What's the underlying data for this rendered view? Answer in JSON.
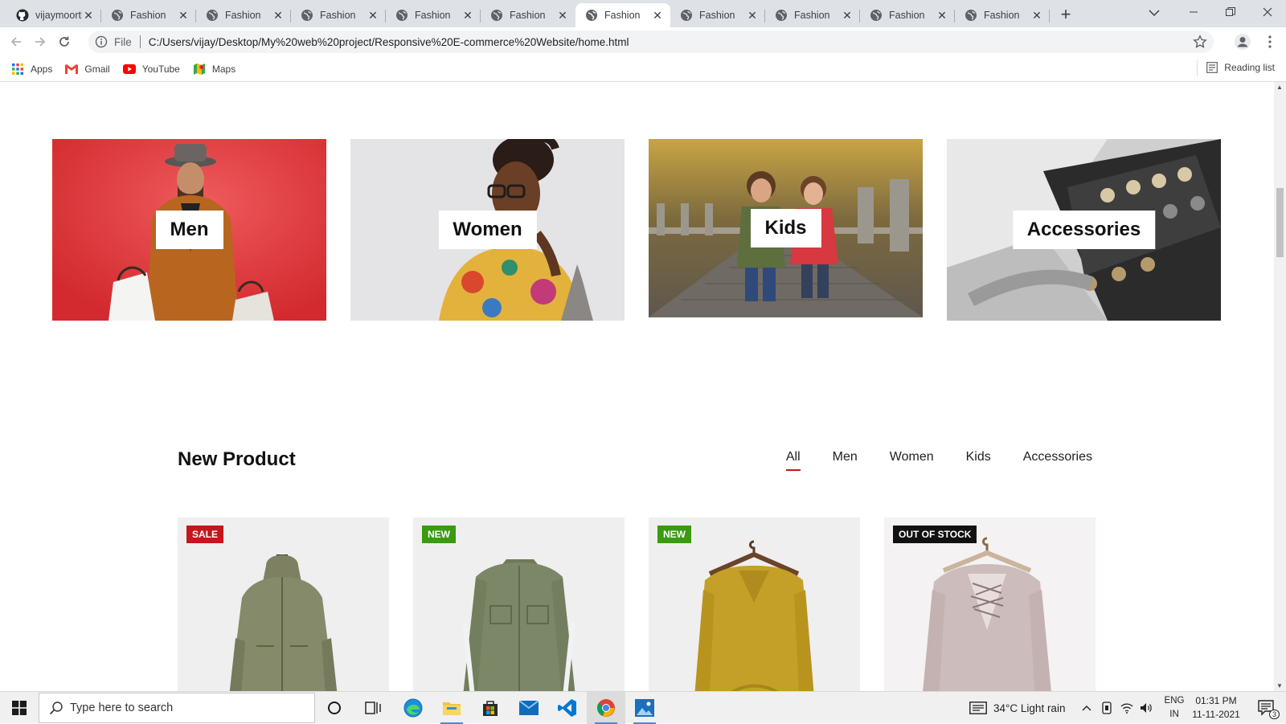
{
  "browser": {
    "tabs": [
      {
        "title": "vijaymoorthy",
        "favicon": "github-icon",
        "active": false
      },
      {
        "title": "Fashion",
        "favicon": "globe-icon",
        "active": false
      },
      {
        "title": "Fashion",
        "favicon": "globe-icon",
        "active": false
      },
      {
        "title": "Fashion",
        "favicon": "globe-icon",
        "active": false
      },
      {
        "title": "Fashion",
        "favicon": "globe-icon",
        "active": false
      },
      {
        "title": "Fashion",
        "favicon": "globe-icon",
        "active": false
      },
      {
        "title": "Fashion",
        "favicon": "globe-icon",
        "active": true
      },
      {
        "title": "Fashion",
        "favicon": "globe-icon",
        "active": false
      },
      {
        "title": "Fashion",
        "favicon": "globe-icon",
        "active": false
      },
      {
        "title": "Fashion",
        "favicon": "globe-icon",
        "active": false
      },
      {
        "title": "Fashion",
        "favicon": "globe-icon",
        "active": false
      }
    ],
    "new_tab_label": "+",
    "address": {
      "scheme_label": "File",
      "url": "C:/Users/vijay/Desktop/My%20web%20project/Responsive%20E-commerce%20Website/home.html"
    },
    "bookmarks": [
      {
        "label": "Apps",
        "icon": "apps-grid-icon"
      },
      {
        "label": "Gmail",
        "icon": "gmail-icon"
      },
      {
        "label": "YouTube",
        "icon": "youtube-icon"
      },
      {
        "label": "Maps",
        "icon": "maps-icon"
      }
    ],
    "reading_list": "Reading list"
  },
  "page": {
    "categories": [
      {
        "label": "Men",
        "image": "man-with-hat-shopping-bags-red-background"
      },
      {
        "label": "Women",
        "image": "woman-glasses-floral-shirt"
      },
      {
        "label": "Kids",
        "image": "two-children-walking-on-path"
      },
      {
        "label": "Accessories",
        "image": "watch-box-display"
      }
    ],
    "new_product": {
      "title": "New Product",
      "filters": [
        "All",
        "Men",
        "Women",
        "Kids",
        "Accessories"
      ],
      "active_filter": "All",
      "products": [
        {
          "badge": "SALE",
          "badge_color": "#c4161c",
          "image": "olive-hooded-jacket"
        },
        {
          "badge": "NEW",
          "badge_color": "#3a9a10",
          "image": "olive-denim-shirt"
        },
        {
          "badge": "NEW",
          "badge_color": "#3a9a10",
          "image": "mustard-knit-sweater"
        },
        {
          "badge": "OUT OF STOCK",
          "badge_color": "#111111",
          "image": "pink-lace-up-sweater"
        }
      ]
    }
  },
  "taskbar": {
    "search_placeholder": "Type here to search",
    "weather": "34°C  Light rain",
    "language": {
      "line1": "ENG",
      "line2": "IN"
    },
    "time": "01:31 PM",
    "date": "11-11-2021",
    "notification_count": "3"
  },
  "colors": {
    "accent_red": "#c4161c",
    "new_green": "#3a9a10",
    "chrome_tabstrip": "#dee1e6"
  }
}
